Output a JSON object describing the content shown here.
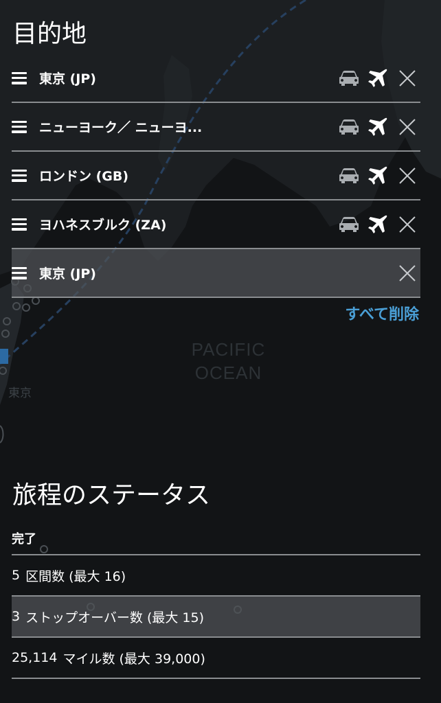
{
  "map": {
    "ocean_label_line1": "PACIFIC",
    "ocean_label_line2": "OCEAN",
    "city_label": "東京"
  },
  "destinations": {
    "title": "目的地",
    "items": [
      {
        "name": "東京 (JP)",
        "car_icon": "car-icon",
        "plane_icon": "plane-icon",
        "close_icon": "close-icon"
      },
      {
        "name": "ニューヨーク／ ニューヨ...",
        "car_icon": "car-icon",
        "plane_icon": "plane-icon",
        "close_icon": "close-icon"
      },
      {
        "name": "ロンドン (GB)",
        "car_icon": "car-icon",
        "plane_icon": "plane-icon",
        "close_icon": "close-icon"
      },
      {
        "name": "ヨハネスブルク (ZA)",
        "car_icon": "car-icon",
        "plane_icon": "plane-icon",
        "close_icon": "close-icon"
      },
      {
        "name": "東京 (JP)",
        "close_icon": "close-icon"
      }
    ],
    "clear_all_label": "すべて削除"
  },
  "status": {
    "title": "旅程のステータス",
    "state": "完了",
    "segments_count": "5",
    "segments_label": "区間数 (最大 16)",
    "stopovers_count": "3",
    "stopovers_label": "ストップオーバー数 (最大 15)",
    "miles_count": "25,114",
    "miles_label": "マイル数 (最大 39,000)"
  },
  "colors": {
    "background": "#121416",
    "accent": "#4a9fd6",
    "divider": "#8a8d90",
    "highlight_row": "#4f5256"
  }
}
